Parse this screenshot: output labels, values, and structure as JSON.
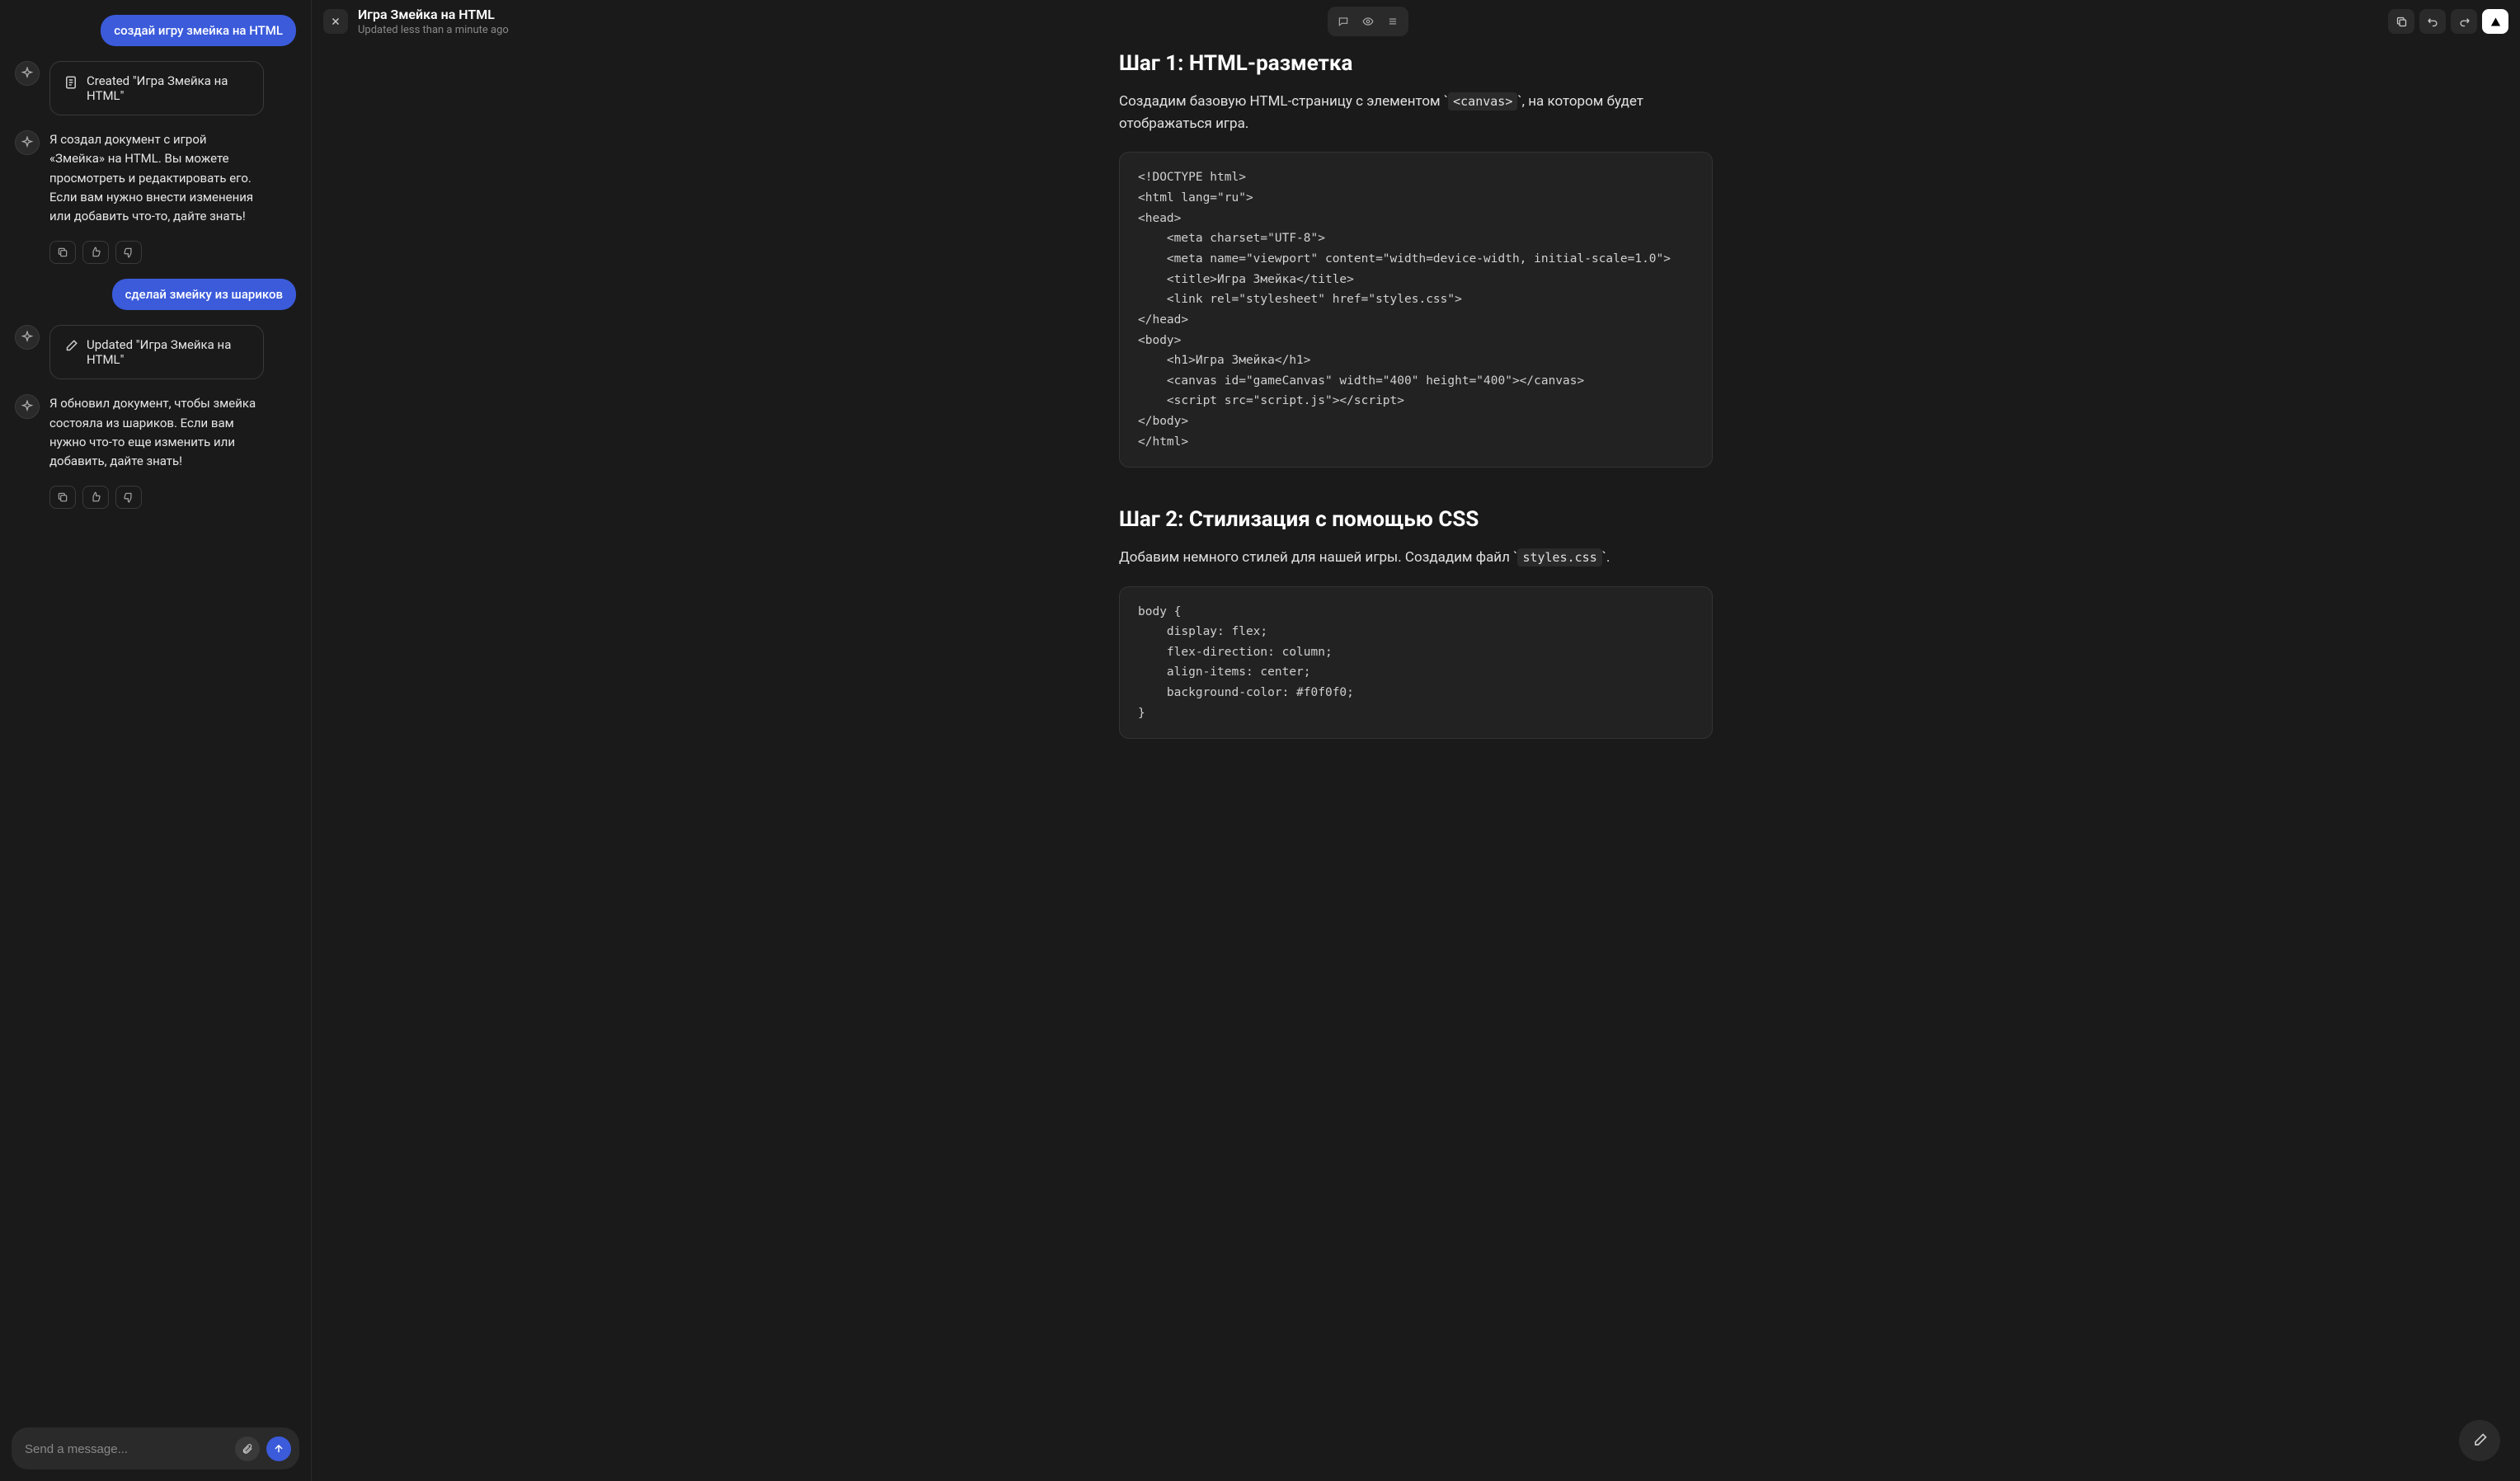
{
  "chat": {
    "messages": {
      "u1": "создай игру змейка на HTML",
      "card1": "Created \"Игра Змейка на HTML\"",
      "a1": "Я создал документ с игрой «Змейка» на HTML. Вы можете просмотреть и редактировать его. Если вам нужно внести изменения или добавить что-то, дайте знать!",
      "u2": "сделай змейку из шариков",
      "card2": "Updated \"Игра Змейка на HTML\"",
      "a2": "Я обновил документ, чтобы змейка состояла из шариков. Если вам нужно что-то еще изменить или добавить, дайте знать!"
    },
    "composer_placeholder": "Send a message..."
  },
  "header": {
    "title": "Игра Змейка на HTML",
    "subtitle": "Updated less than a minute ago"
  },
  "doc": {
    "step1_title": "Шаг 1: HTML-разметка",
    "step1_p_a": "Создадим базовую HTML-страницу с элементом ",
    "step1_code_inline": "<canvas>",
    "step1_p_b": ", на котором будет отображаться игра.",
    "code1": "<!DOCTYPE html>\n<html lang=\"ru\">\n<head>\n    <meta charset=\"UTF-8\">\n    <meta name=\"viewport\" content=\"width=device-width, initial-scale=1.0\">\n    <title>Игра Змейка</title>\n    <link rel=\"stylesheet\" href=\"styles.css\">\n</head>\n<body>\n    <h1>Игра Змейка</h1>\n    <canvas id=\"gameCanvas\" width=\"400\" height=\"400\"></canvas>\n    <script src=\"script.js\"></​script>\n</body>\n</html>",
    "step2_title": "Шаг 2: Стилизация с помощью CSS",
    "step2_p_a": "Добавим немного стилей для нашей игры. Создадим файл ",
    "step2_code_inline": "styles.css",
    "step2_p_b": ".",
    "code2": "body {\n    display: flex;\n    flex-direction: column;\n    align-items: center;\n    background-color: #f0f0f0;\n}"
  }
}
